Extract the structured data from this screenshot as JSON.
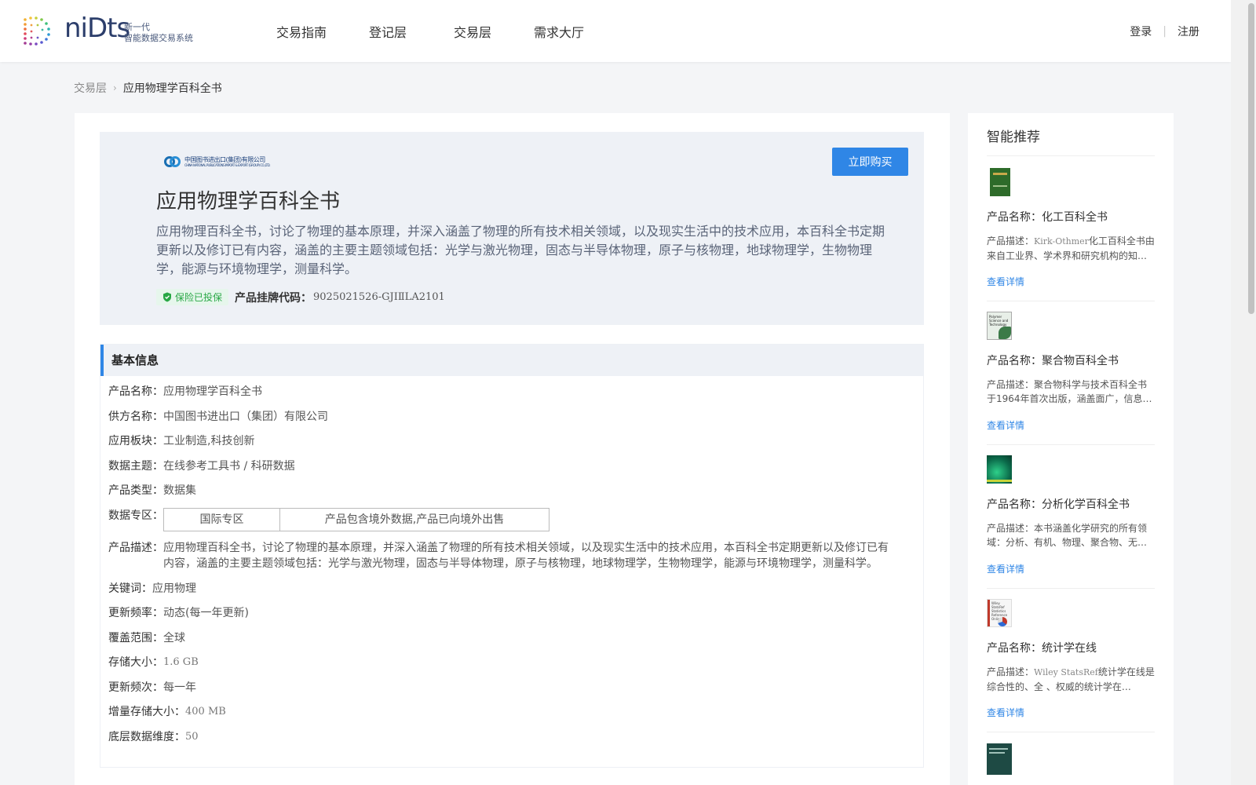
{
  "header": {
    "logo_word": "niDts",
    "logo_sub_line1": "新一代",
    "logo_sub_line2": "智能数据交易系统",
    "nav": [
      "交易指南",
      "登记层",
      "交易层",
      "需求大厅"
    ],
    "login": "登录",
    "separator": "|",
    "register": "注册"
  },
  "breadcrumb": {
    "parent": "交易层",
    "separator": "›",
    "current": "应用物理学百科全书"
  },
  "hero": {
    "publisher_logo_text_1": "中国图书进出口(集团)有限公司",
    "publisher_logo_text_2": "CHINA NATIONAL PUBLICATIONS IMPORT & EXPORT (GROUP) CO.,LTD.",
    "title": "应用物理学百科全书",
    "description": "应用物理百科全书，讨论了物理的基本原理，并深入涵盖了物理的所有技术相关领域，以及现实生活中的技术应用，本百科全书定期更新以及修订已有内容，涵盖的主要主题领域包括：光学与激光物理，固态与半导体物理，原子与核物理，地球物理学，生物物理学，能源与环境物理学，测量科学。",
    "insurance_badge": "保险已投保",
    "code_label": "产品挂牌代码：",
    "code_value": "9025021526-GJIⅡLA2101",
    "buy_button": "立即购买",
    "colors": {
      "accent": "#2f86e6",
      "badge_green": "#28a745",
      "hero_bg": "#eef1f6"
    }
  },
  "basic_info": {
    "heading": "基本信息",
    "product_name_label": "产品名称：",
    "product_name": "应用物理学百科全书",
    "supplier_label": "供方名称：",
    "supplier": "中国图书进出口（集团）有限公司",
    "sector_label": "应用板块：",
    "sector": "工业制造,科技创新",
    "theme_label": "数据主题：",
    "theme": "在线参考工具书 / 科研数据",
    "type_label": "产品类型：",
    "type": "数据集",
    "zone_label": "数据专区：",
    "zone_cells": [
      "国际专区",
      "产品包含境外数据,产品已向境外出售"
    ],
    "desc_label": "产品描述：",
    "desc": "应用物理百科全书，讨论了物理的基本原理，并深入涵盖了物理的所有技术相关领域，以及现实生活中的技术应用，本百科全书定期更新以及修订已有内容，涵盖的主要主题领域包括：光学与激光物理，固态与半导体物理，原子与核物理，地球物理学，生物物理学，能源与环境物理学，测量科学。",
    "keyword_label": "关键词：",
    "keyword": "应用物理",
    "frequency_label": "更新频率：",
    "frequency": "动态(每一年更新)",
    "coverage_label": "覆盖范围：",
    "coverage": "全球",
    "storage_label": "存储大小：",
    "storage": "1.6 GB",
    "update_count_label": "更新频次：",
    "update_count": "每一年",
    "increment_label": "增量存储大小：",
    "increment": "400 MB",
    "dimension_label": "底层数据维度：",
    "dimension": "50"
  },
  "sidebar": {
    "title": "智能推荐",
    "name_prefix": "产品名称：",
    "desc_prefix": "产品描述：",
    "more": "查看详情",
    "items": [
      {
        "name": "化工百科全书",
        "desc_latin": "Kirk-Othmer",
        "desc": "化工百科全书由来自工业界、学术界和研究机构的知…",
        "cover_color": "#2e6b2a",
        "cover_icon": "green-book-cover"
      },
      {
        "name": "聚合物百科全书",
        "desc_latin": "",
        "desc": "聚合物科学与技术百科全书于1964年首次出版，涵盖面广，信息…",
        "cover_color": "#e8efe8",
        "cover_icon": "polymer-book-cover",
        "cover_text": "Polymer Science and Technology"
      },
      {
        "name": "分析化学百科全书",
        "desc_latin": "",
        "desc": "本书涵盖化学研究的所有领域：分析、有机、物理、聚合物、无…",
        "cover_color": "#0b8a5c",
        "cover_icon": "teal-book-cover"
      },
      {
        "name": "统计学在线",
        "desc_latin": "Wiley StatsRef",
        "desc": "统计学在线是综合性的、全 、权威的统计学在…",
        "cover_color": "#f3f3f3",
        "cover_icon": "statsref-book-cover",
        "cover_text": "Wiley StatsRef Statistics Reference Online"
      }
    ]
  }
}
